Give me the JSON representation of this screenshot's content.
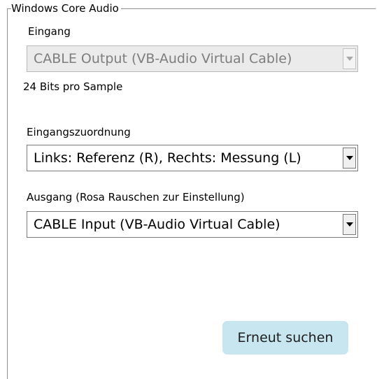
{
  "group": {
    "title": "Windows Core Audio"
  },
  "input": {
    "label": "Eingang",
    "selected": "CABLE Output (VB-Audio Virtual Cable)",
    "enabled": false,
    "info": "24 Bits pro Sample"
  },
  "channel_mapping": {
    "label": "Eingangszuordnung",
    "selected": "Links: Referenz (R), Rechts: Messung (L)"
  },
  "output": {
    "label": "Ausgang (Rosa Rauschen zur Einstellung)",
    "selected": "CABLE Input (VB-Audio Virtual Cable)"
  },
  "buttons": {
    "rescan_label": "Erneut suchen"
  },
  "colors": {
    "button_background": "#c8e6ef",
    "disabled_text": "#7d7d7d",
    "disabled_field": "#ebebeb"
  }
}
